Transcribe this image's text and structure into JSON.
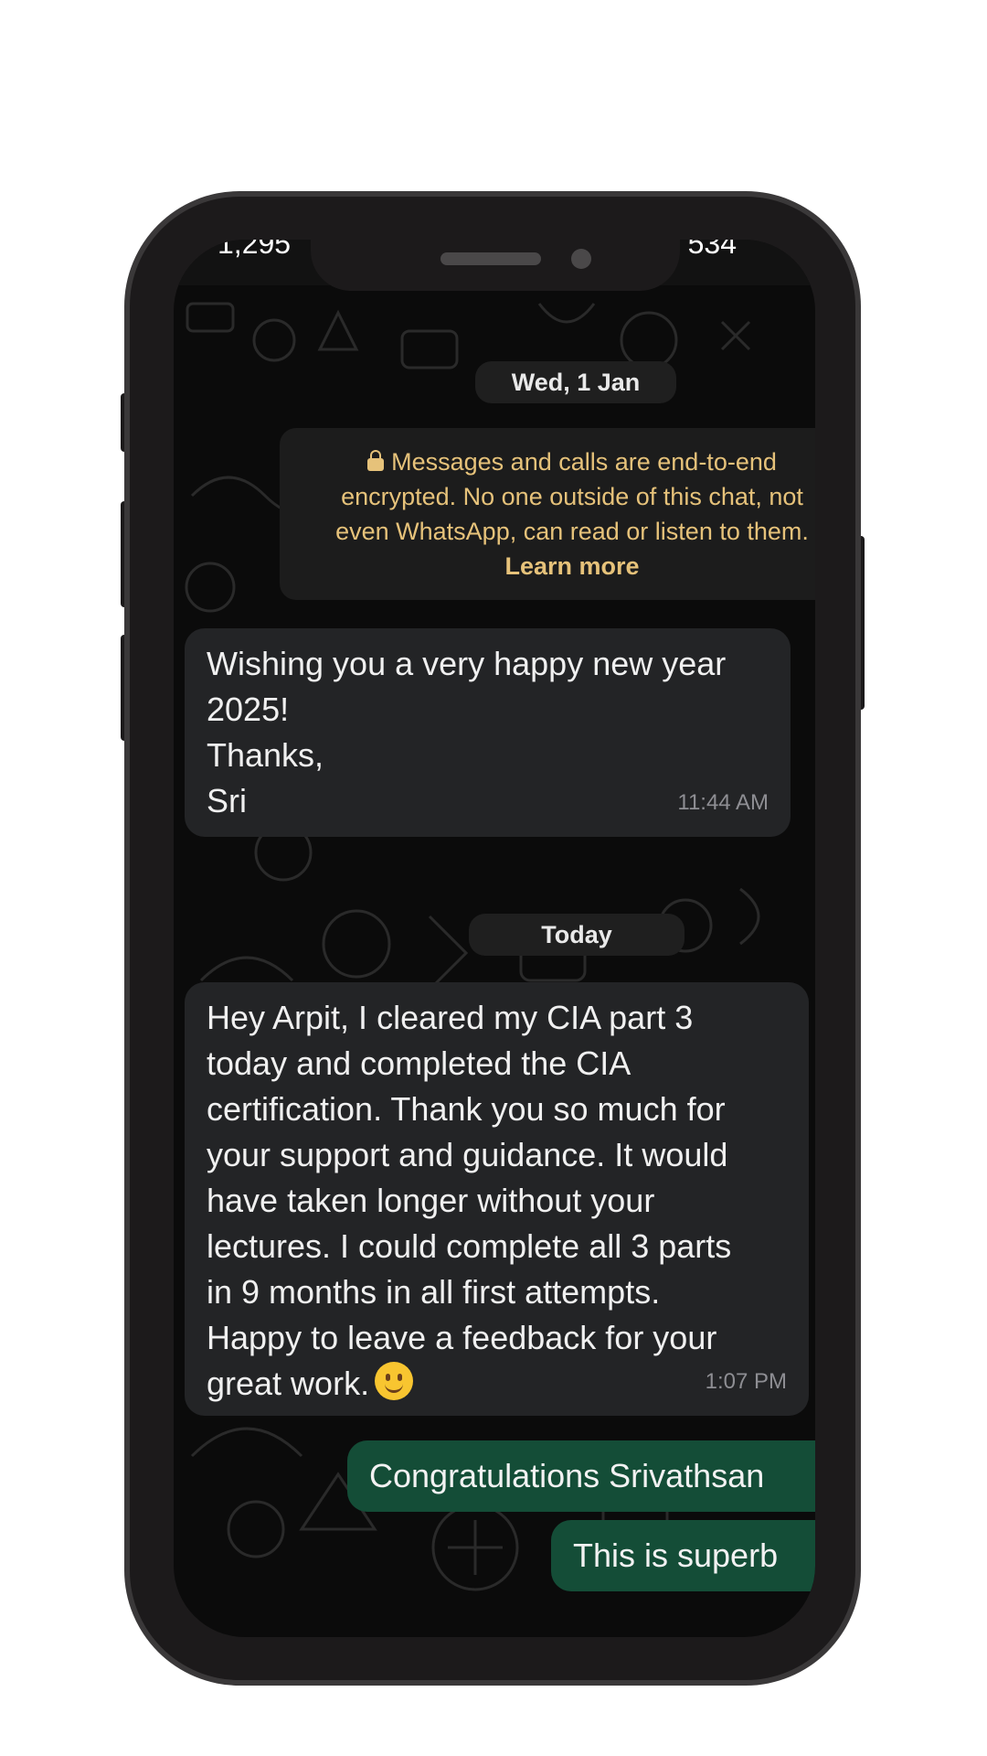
{
  "statusbar": {
    "left_text": "1,295",
    "right_text": "534"
  },
  "chat": {
    "date_separator_1": "Wed, 1 Jan",
    "encryption_notice": {
      "lines": [
        "Messages and calls are end-to-end",
        "encrypted. No one outside of this chat, not",
        "even WhatsApp, can read or listen to them."
      ],
      "link": "Learn more"
    },
    "message_1": {
      "text": "Wishing you a very happy new year\n2025!\nThanks,\nSri",
      "time": "11:44 AM"
    },
    "date_separator_2": "Today",
    "message_2": {
      "text": "Hey Arpit, I cleared my CIA part 3\ntoday and completed the CIA\ncertification. Thank you so much for\nyour support and guidance. It would\nhave taken longer without your\nlectures. I could complete all 3 parts\nin 9 months in all first attempts.\nHappy to leave a feedback for your\ngreat work.",
      "emoji": "slightly-smiling-face",
      "time": "1:07 PM"
    },
    "sent_1": {
      "text": "Congratulations Srivathsan"
    },
    "sent_2": {
      "text": "This is superb"
    }
  },
  "colors": {
    "incoming_bubble": "#232426",
    "outgoing_bubble": "#144d37",
    "encryption_text": "#e6c27a",
    "background": "#0b0b0b"
  }
}
